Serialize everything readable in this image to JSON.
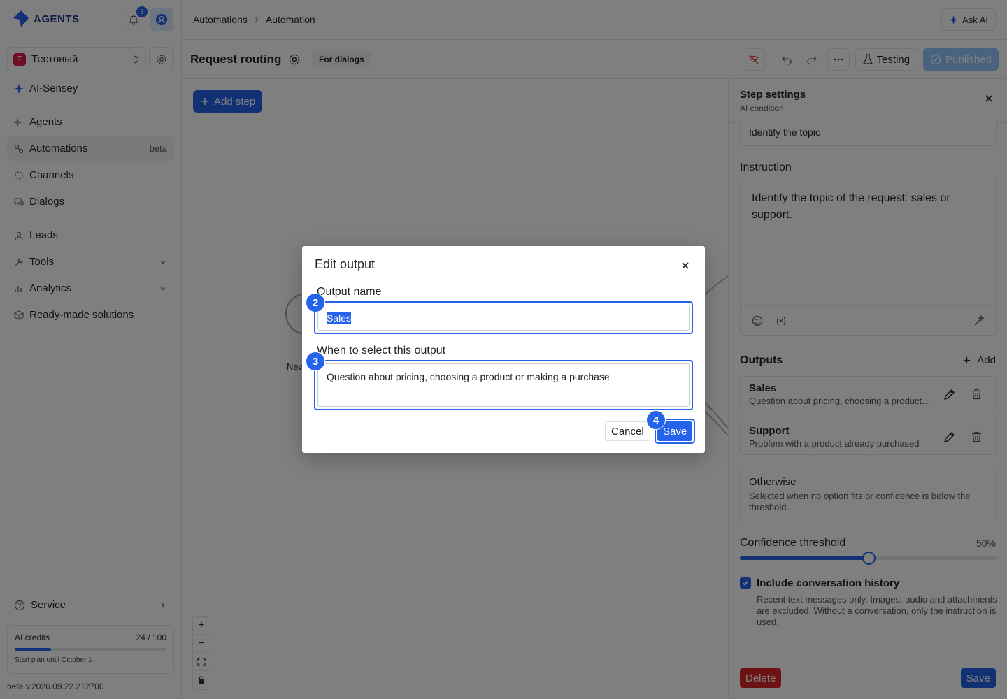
{
  "sidebar": {
    "logo_text": "AGENTS",
    "notification_count": "3",
    "workspace": {
      "badge": "T",
      "name": "Тестовый"
    },
    "ai_item": "AI-Sensey",
    "items": [
      {
        "label": "Agents"
      },
      {
        "label": "Automations",
        "tag": "beta",
        "active": true
      },
      {
        "label": "Channels"
      },
      {
        "label": "Dialogs"
      },
      {
        "label": "Leads"
      },
      {
        "label": "Tools",
        "expandable": true
      },
      {
        "label": "Analytics",
        "expandable": true
      },
      {
        "label": "Ready-made solutions"
      }
    ],
    "service": "Service",
    "credits": {
      "label": "AI credits",
      "value": "24 / 100",
      "fraction": 0.24,
      "plan": "Start plan until October 1"
    },
    "version": "beta v.2026.09.22.212700"
  },
  "header": {
    "breadcrumb": [
      "Automations",
      "Automation"
    ],
    "ask_ai": "Ask AI"
  },
  "toolbar": {
    "title": "Request routing",
    "badge": "For dialogs",
    "testing": "Testing",
    "published": "Published"
  },
  "canvas": {
    "add_step": "Add step",
    "node_label": "New"
  },
  "step_panel": {
    "title": "Step settings",
    "subtitle": "AI condition",
    "name_value": "Identify the topic",
    "instruction_label": "Instruction",
    "instruction_text": "Identify the topic of the request: sales or support.",
    "outputs_label": "Outputs",
    "add_label": "Add",
    "outputs": [
      {
        "title": "Sales",
        "desc": "Question about pricing, choosing a product or making a purchase"
      },
      {
        "title": "Support",
        "desc": "Problem with a product already purchased"
      }
    ],
    "otherwise": {
      "title": "Otherwise",
      "desc": "Selected when no option fits or confidence is below the threshold."
    },
    "confidence_label": "Confidence threshold",
    "confidence_value": "50%",
    "confidence_fraction": 0.5,
    "history_label": "Include conversation history",
    "history_desc": "Recent text messages only. Images, audio and attachments are excluded. Without a conversation, only the instruction is used.",
    "delete": "Delete",
    "save": "Save"
  },
  "modal": {
    "title": "Edit output",
    "name_label": "Output name",
    "name_value": "Sales",
    "condition_label": "When to select this output",
    "condition_value": "Question about pricing, choosing a product or making a purchase",
    "cancel": "Cancel",
    "save": "Save"
  },
  "markers": [
    "2",
    "3",
    "4"
  ],
  "colors": {
    "accent": "#2563eb",
    "danger": "#dc2626",
    "overlay": "rgba(0,0,0,0.5)"
  }
}
